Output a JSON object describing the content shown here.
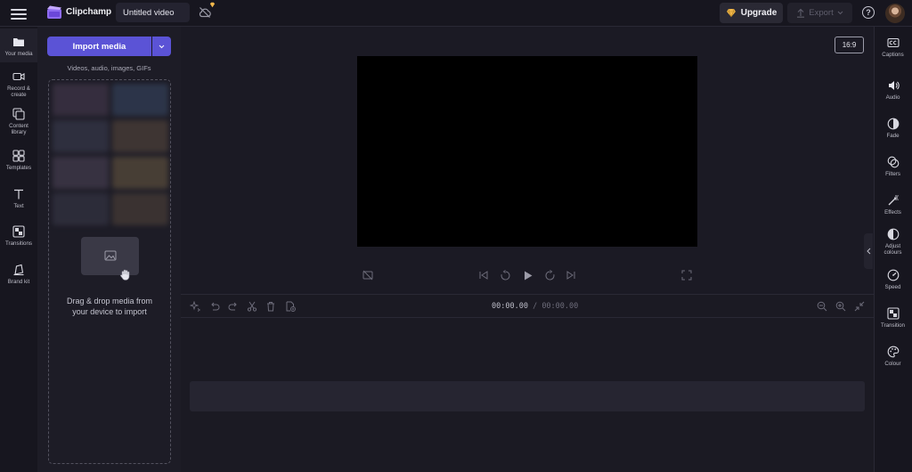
{
  "app": {
    "brand": "Clipchamp",
    "project_title": "Untitled video"
  },
  "topbar": {
    "upgrade_label": "Upgrade",
    "export_label": "Export",
    "help_label": "?"
  },
  "leftnav": {
    "items": [
      {
        "label": "Your media",
        "icon": "folder-icon"
      },
      {
        "label": "Record & create",
        "icon": "camera-icon"
      },
      {
        "label": "Content library",
        "icon": "library-icon"
      },
      {
        "label": "Templates",
        "icon": "templates-icon"
      },
      {
        "label": "Text",
        "icon": "text-icon"
      },
      {
        "label": "Transitions",
        "icon": "transitions-icon"
      },
      {
        "label": "Brand kit",
        "icon": "brand-kit-icon"
      }
    ]
  },
  "media": {
    "import_label": "Import media",
    "hint": "Videos, audio, images, GIFs",
    "drop_text_1": "Drag & drop media from",
    "drop_text_2": "your device to import"
  },
  "preview": {
    "aspect_ratio": "16:9"
  },
  "timeline": {
    "current_time": "00:00.00",
    "total_time": "/ 00:00.00"
  },
  "rightnav": {
    "items": [
      {
        "label": "Captions",
        "icon": "captions-icon"
      },
      {
        "label": "Audio",
        "icon": "speaker-icon"
      },
      {
        "label": "Fade",
        "icon": "fade-icon"
      },
      {
        "label": "Filters",
        "icon": "filters-icon"
      },
      {
        "label": "Effects",
        "icon": "effects-icon"
      },
      {
        "label": "Adjust colours",
        "icon": "adjust-colours-icon"
      },
      {
        "label": "Speed",
        "icon": "speed-icon"
      },
      {
        "label": "Transition",
        "icon": "transition-icon"
      },
      {
        "label": "Colour",
        "icon": "palette-icon"
      }
    ]
  },
  "colors": {
    "accent": "#5b53d6",
    "background": "#1b1a24",
    "panel": "#17161f",
    "gem": "#f2b84b"
  }
}
